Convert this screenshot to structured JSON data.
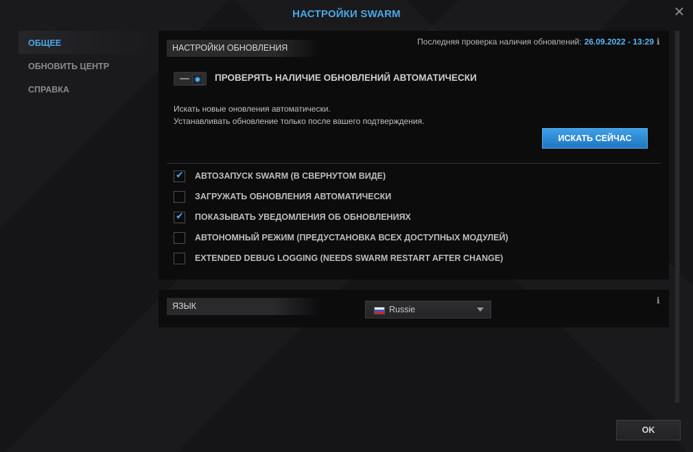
{
  "window": {
    "title": "НАСТРОЙКИ SWARM",
    "close_icon": "close-icon",
    "ok_label": "OK"
  },
  "sidebar": {
    "items": [
      {
        "label": "ОБЩЕЕ",
        "active": true
      },
      {
        "label": "ОБНОВИТЬ ЦЕНТР",
        "active": false
      },
      {
        "label": "СПРАВКА",
        "active": false
      }
    ]
  },
  "updates": {
    "section_title": "НАСТРОЙКИ ОБНОВЛЕНИЯ",
    "last_check_label": "Последняя проверка наличия обновлений:",
    "last_check_value": "26.09.2022 - 13:29",
    "auto_check_label": "ПРОВЕРЯТЬ НАЛИЧИЕ ОБНОВЛЕНИЙ АВТОМАТИЧЕСКИ",
    "auto_check_enabled": true,
    "description_line1": "Искать новые оновления автоматически.",
    "description_line2": "Устанавливать обновление только после вашего подтверждения.",
    "search_now_label": "ИСКАТЬ СЕЙЧАС",
    "info_glyph": "i"
  },
  "options": [
    {
      "label": "АВТОЗАПУСК SWARM (В СВЕРНУТОМ ВИДЕ)",
      "checked": true
    },
    {
      "label": "ЗАГРУЖАТЬ ОБНОВЛЕНИЯ АВТОМАТИЧЕСКИ",
      "checked": false
    },
    {
      "label": "ПОКАЗЫВАТЬ УВЕДОМЛЕНИЯ ОБ ОБНОВЛЕНИЯХ",
      "checked": true
    },
    {
      "label": "АВТОНОМНЫЙ РЕЖИМ (ПРЕДУСТАНОВКА ВСЕХ ДОСТУПНЫХ МОДУЛЕЙ)",
      "checked": false
    },
    {
      "label": "EXTENDED DEBUG LOGGING (NEEDS SWARM RESTART AFTER CHANGE)",
      "checked": false
    }
  ],
  "language": {
    "section_title": "ЯЗЫК",
    "selected": "Russie",
    "info_glyph": "i"
  },
  "colors": {
    "accent": "#4aa8e8",
    "button_blue": "#1f76c2"
  }
}
